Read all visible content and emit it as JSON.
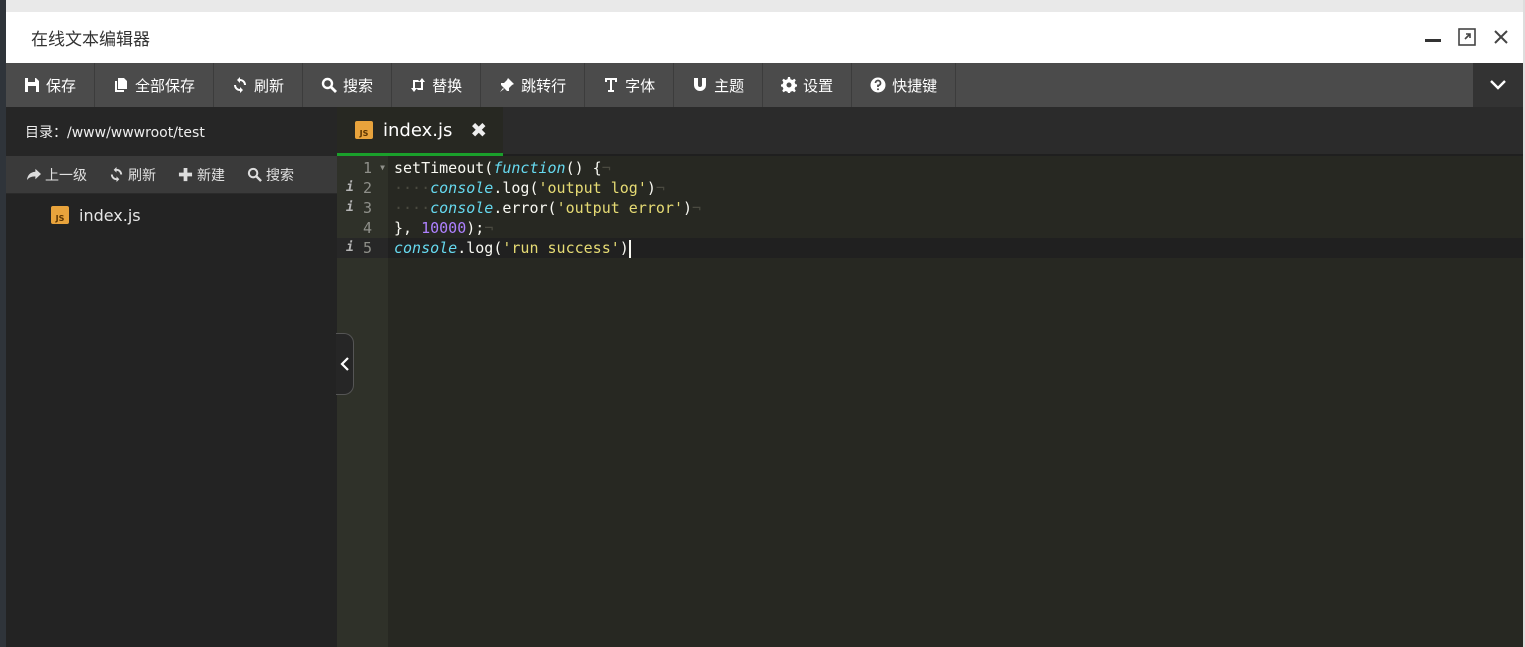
{
  "window": {
    "title": "在线文本编辑器"
  },
  "toolbar": {
    "buttons": [
      {
        "label": "保存",
        "icon": "save-icon"
      },
      {
        "label": "全部保存",
        "icon": "copy-icon"
      },
      {
        "label": "刷新",
        "icon": "refresh-icon"
      },
      {
        "label": "搜索",
        "icon": "search-icon"
      },
      {
        "label": "替换",
        "icon": "retweet-icon"
      },
      {
        "label": "跳转行",
        "icon": "pin-icon"
      },
      {
        "label": "字体",
        "icon": "text-cursor-icon"
      },
      {
        "label": "主题",
        "icon": "magnet-icon"
      },
      {
        "label": "设置",
        "icon": "gear-icon"
      },
      {
        "label": "快捷键",
        "icon": "question-icon"
      }
    ]
  },
  "sidebar": {
    "directory": "目录：/www/wwwroot/test",
    "actions": [
      {
        "label": "上一级",
        "icon": "share-arrow-icon"
      },
      {
        "label": "刷新",
        "icon": "refresh-icon"
      },
      {
        "label": "新建",
        "icon": "plus-icon"
      },
      {
        "label": "搜索",
        "icon": "search-icon"
      }
    ],
    "files": [
      {
        "name": "index.js",
        "icon_text": "JS"
      }
    ]
  },
  "tabs": [
    {
      "label": "index.js",
      "icon_text": "JS",
      "active": true
    }
  ],
  "editor": {
    "line_numbers": [
      "1",
      "2",
      "3",
      "4",
      "5"
    ],
    "info_marker": "i",
    "code": {
      "l1_a": "setTimeout(",
      "l1_b": "function",
      "l1_c": "() {",
      "l2_ws": "····",
      "l2_a": "console",
      "l2_b": ".log(",
      "l2_c": "'output log'",
      "l2_d": ")",
      "l3_ws": "····",
      "l3_a": "console",
      "l3_b": ".error(",
      "l3_c": "'output error'",
      "l3_d": ")",
      "l4_a": "}, ",
      "l4_b": "10000",
      "l4_c": ");",
      "l5_a": "console",
      "l5_b": ".log(",
      "l5_c": "'run success'",
      "l5_d": ")",
      "eol": "¬"
    }
  },
  "colors": {
    "editor_bg": "#272822",
    "toolbar_bg": "#4b4b4b",
    "tab_accent": "#1aa02b",
    "js_icon": "#e8a33c"
  }
}
